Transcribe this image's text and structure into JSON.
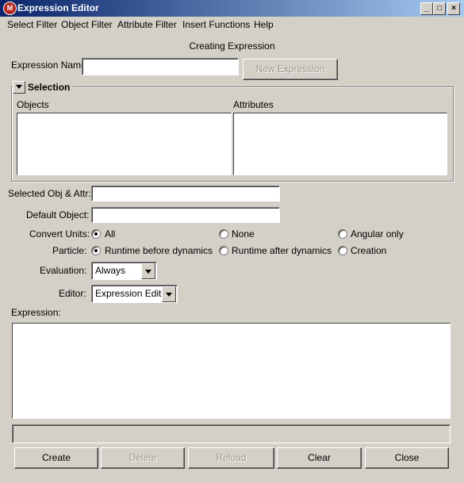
{
  "window": {
    "title": "Expression Editor",
    "min_glyph": "_",
    "max_glyph": "□",
    "close_glyph": "×",
    "icon": "maya-app-icon"
  },
  "menu": [
    "Select Filter",
    "Object Filter",
    "Attribute Filter",
    "Insert Functions",
    "Help"
  ],
  "status_heading": "Creating Expression",
  "expression_name": {
    "label": "Expression Name",
    "value": ""
  },
  "new_expression_button": "New Expression",
  "selection": {
    "title": "Selection",
    "objects_label": "Objects",
    "attributes_label": "Attributes"
  },
  "selected_obj_attr": {
    "label": "Selected Obj & Attr:",
    "value": ""
  },
  "default_object": {
    "label": "Default Object:",
    "value": ""
  },
  "convert_units": {
    "label": "Convert Units:",
    "options": [
      "All",
      "None",
      "Angular only"
    ],
    "selected": "All"
  },
  "particle": {
    "label": "Particle:",
    "options": [
      "Runtime before dynamics",
      "Runtime after dynamics",
      "Creation"
    ],
    "selected": "Runtime before dynamics"
  },
  "evaluation": {
    "label": "Evaluation:",
    "value": "Always"
  },
  "editor": {
    "label": "Editor:",
    "value": "Expression Editor"
  },
  "expression": {
    "label": "Expression:",
    "value": ""
  },
  "buttons": {
    "create": "Create",
    "delete": "Delete",
    "reload": "Reload",
    "clear": "Clear",
    "close": "Close"
  }
}
